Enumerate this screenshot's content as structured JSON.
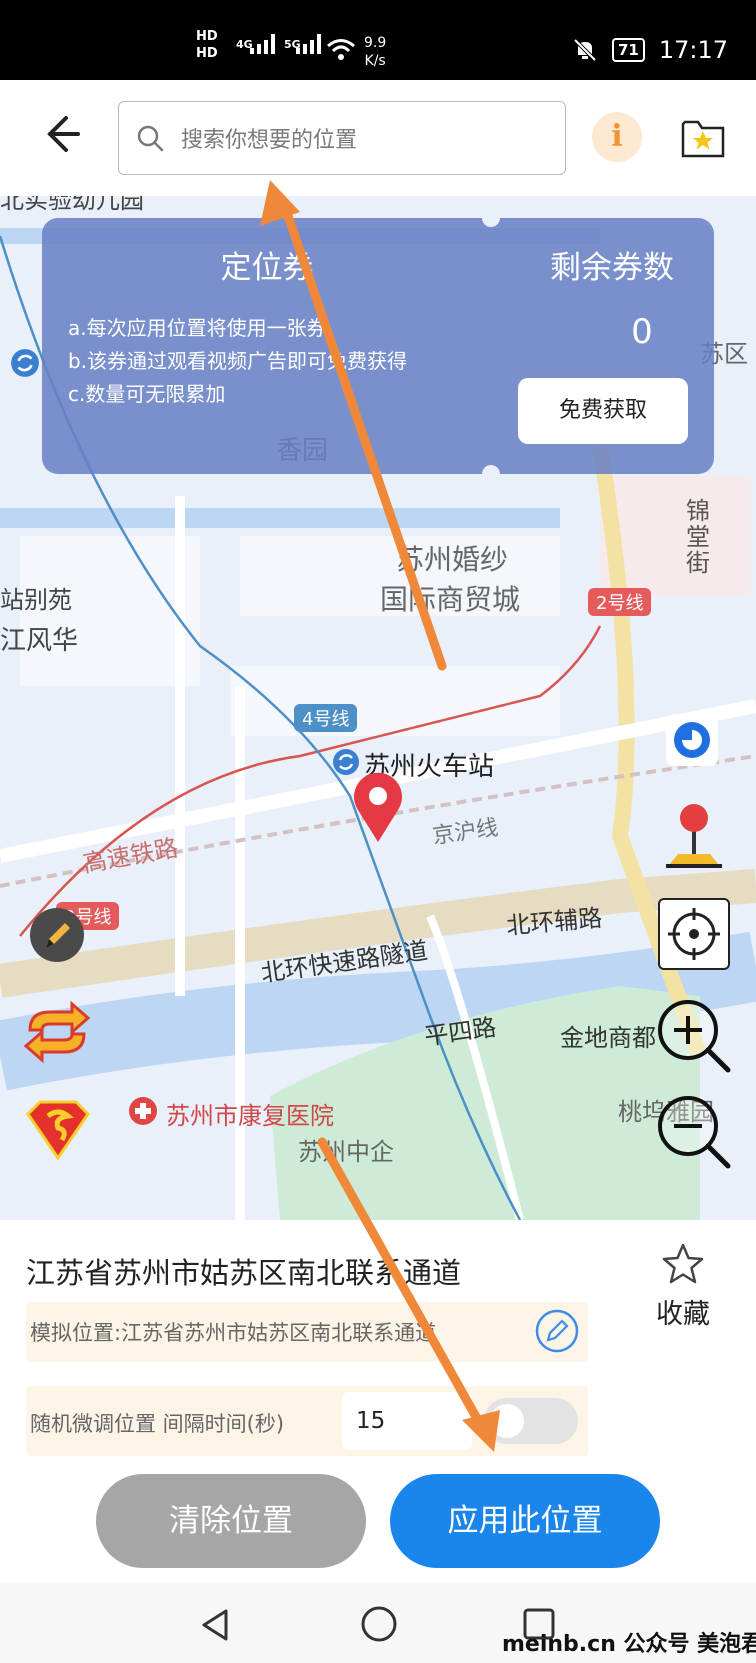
{
  "status_bar": {
    "hd_top": "HD",
    "hd_bottom": "HD",
    "net_4g": "4G",
    "net_5g": "5G",
    "speed_value": "9.9",
    "speed_unit": "K/s",
    "battery": "71",
    "time": "17:17"
  },
  "header": {
    "search_placeholder": "搜索你想要的位置",
    "info_label": "i"
  },
  "coupon": {
    "title": "定位券",
    "remaining_title": "剩余券数",
    "remaining_count": "0",
    "rules": [
      "a.每次应用位置将使用一张券",
      "b.该券通过观看视频广告即可免费获得",
      "c.数量可无限累加"
    ],
    "get_button": "免费获取"
  },
  "map": {
    "labels": {
      "kindergarten": "北实验幼儿园",
      "xiangyuan": "香园",
      "wedding_center": "苏州婚纱",
      "wedding_center_2": "国际商贸城",
      "jintang_street": "锦堂街",
      "station_garden": "站别苑",
      "jiangfenghua": "江风华",
      "line2_top": "2号线",
      "line4": "4号线",
      "station": "苏州火车站",
      "jinghu_line": "京沪线",
      "hsr": "高速铁路",
      "line2_left": "2号线",
      "north_ring_aux": "北环辅路",
      "north_ring_tunnel": "北环快速路隧道",
      "pingsi_road": "平四路",
      "jindi_mall": "金地商都",
      "hospital": "苏州市康复医院",
      "taowu": "桃坞雅园",
      "zhongqi": "苏州中企",
      "district_edge": "苏区"
    }
  },
  "panel": {
    "address": "江苏省苏州市姑苏区南北联系通道",
    "favorite_label": "收藏",
    "simulated_location": "模拟位置:江苏省苏州市姑苏区南北联系通道",
    "random_label": "随机微调位置 间隔时间(秒)",
    "interval_value": "15",
    "clear_button": "清除位置",
    "apply_button": "应用此位置"
  },
  "watermark": "meinb.cn  公众号 美泡君"
}
